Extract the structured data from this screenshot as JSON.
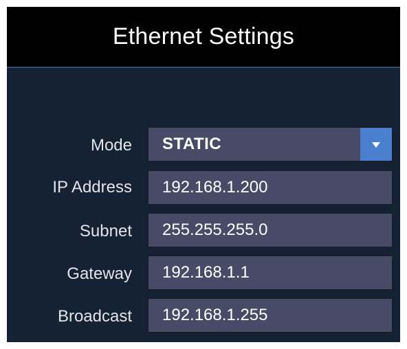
{
  "window": {
    "title": "Ethernet Settings"
  },
  "form": {
    "mode": {
      "label": "Mode",
      "value": "STATIC",
      "dropdown_icon": "triangle-down-icon"
    },
    "ip_address": {
      "label": "IP Address",
      "value": "192.168.1.200"
    },
    "subnet": {
      "label": "Subnet",
      "value": "255.255.255.0"
    },
    "gateway": {
      "label": "Gateway",
      "value": "192.168.1.1"
    },
    "broadcast": {
      "label": "Broadcast",
      "value": "192.168.1.255"
    }
  },
  "colors": {
    "panel_background": "#142234",
    "title_background": "#000000",
    "field_background": "#484b67",
    "dropdown_accent": "#4a7fcf"
  }
}
